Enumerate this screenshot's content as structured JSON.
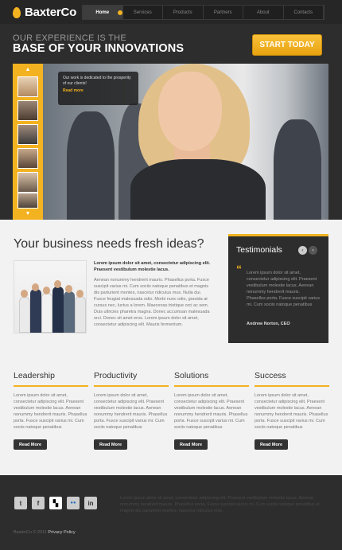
{
  "brand": {
    "name": "BaxterCo",
    "accent": "#f3b21f"
  },
  "nav": {
    "items": [
      "Home",
      "Services",
      "Products",
      "Partners",
      "About",
      "Contacts"
    ],
    "active": "Home"
  },
  "header": {
    "tagline_small": "OUR EXPERIENCE IS THE",
    "tagline_big": "BASE OF YOUR INNOVATIONS",
    "cta": "START TODAY"
  },
  "hero": {
    "caption": "Our work is dedicated to the prosperity of our clients!",
    "caption_link": "Read more",
    "thumbs": [
      "thumb-1",
      "thumb-2",
      "thumb-3",
      "thumb-4",
      "thumb-5",
      "thumb-6"
    ]
  },
  "main": {
    "title": "Your business needs fresh ideas?",
    "lead": "Lorem ipsum dolor sit amet, consectetur adipiscing elit. Praesent vestibulum molestie lacus.",
    "body": "Aenean nonummy hendrerit mauris. Phasellus porta. Fusce suscipit varius mi. Cum sociis natoque penatibus et magnis dis parturient montes, nascetur ridiculus mus. Nulla dui. Fusce feugiat malesuada odio. Morbi nunc odio, gravida at cursus nec, luctus a lorem. Maecenas tristique orci ac sem. Duis ultricies pharetra magna. Donec accumsan malesuada orci. Donec sit amet eros. Lorem ipsum dolor sit amet, consectetur adipiscing elit. Mauris fermentum."
  },
  "testimonials": {
    "title": "Testimonials",
    "quote": "Lorem ipsum dolor sit amet, consectetur adipiscing elit. Praesent vestibulum molestie lacus. Aenean nonummy hendrerit mauris. Phasellus porta. Fusce suscipit varius mi. Cum sociis natoque penatibus",
    "author": "Andrew Norton, CEO",
    "prev": "‹",
    "next": "›"
  },
  "features": [
    {
      "title": "Leadership",
      "text": "Lorem ipsum dolor sit amet, consectetur adipiscing elit. Praesent vestibulum molestie lacus. Aenean nonummy hendrerit mauris. Phasellus porta. Fusce suscipit varius mi. Cum sociis natoque penatibus",
      "button": "Read More"
    },
    {
      "title": "Productivity",
      "text": "Lorem ipsum dolor sit amet, consectetur adipiscing elit. Praesent vestibulum molestie lacus. Aenean nonummy hendrerit mauris. Phasellus porta. Fusce suscipit varius mi. Cum sociis natoque penatibus",
      "button": "Read More"
    },
    {
      "title": "Solutions",
      "text": "Lorem ipsum dolor sit amet, consectetur adipiscing elit. Praesent vestibulum molestie lacus. Aenean nonummy hendrerit mauris. Phasellus porta. Fusce suscipit varius mi. Cum sociis natoque penatibus",
      "button": "Read More"
    },
    {
      "title": "Success",
      "text": "Lorem ipsum dolor sit amet, consectetur adipiscing elit. Praesent vestibulum molestie lacus. Aenean nonummy hendrerit mauris. Phasellus porta. Fusce suscipit varius mi. Cum sociis natoque penatibus",
      "button": "Read More"
    }
  ],
  "footer": {
    "social": [
      {
        "name": "twitter",
        "glyph": "t"
      },
      {
        "name": "facebook",
        "glyph": "f"
      },
      {
        "name": "delicious",
        "glyph": "▚"
      },
      {
        "name": "flickr",
        "glyph": "●●"
      },
      {
        "name": "linkedin",
        "glyph": "in"
      }
    ],
    "text": "Lorem ipsum dolor sit amet, consectetur adipiscing elit. Praesent vestibulum molestie lacus. Aenean nonummy hendrerit mauris. Phasellus porta. Fusce suscipit varius mi. Cum sociis natoque penatibus et magnis dis parturient montes, nascetur ridiculus mus.",
    "copyright": "BaxterCo © 2011",
    "privacy": "Privacy Policy"
  }
}
